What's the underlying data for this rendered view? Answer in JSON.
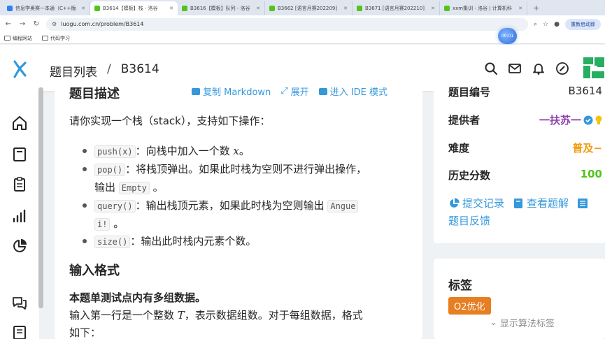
{
  "browser": {
    "tabs": [
      {
        "label": "信息学奥赛一本通（C++版",
        "favicon_color": "#2f80ed",
        "active": false
      },
      {
        "label": "B3614【模板】栈 - 洛谷",
        "favicon_color": "#52c41a",
        "active": true
      },
      {
        "label": "B3616【模板】队列 - 洛谷",
        "favicon_color": "#52c41a",
        "active": false
      },
      {
        "label": "B3662 [语言月赛202209]",
        "favicon_color": "#52c41a",
        "active": false
      },
      {
        "label": "B3671 [语言月赛202210]",
        "favicon_color": "#52c41a",
        "active": false
      },
      {
        "label": "xxm集训 - 洛谷 | 计算机科",
        "favicon_color": "#52c41a",
        "active": false
      }
    ],
    "new_tab": "+",
    "url": "luogu.com.cn/problem/B3614",
    "restart_label": "重新启动即",
    "bookmarks": [
      "编程网站",
      "代码学习"
    ],
    "recording_time": "00:01"
  },
  "header": {
    "breadcrumb_root": "题目列表",
    "breadcrumb_sep": "/",
    "breadcrumb_current": "B3614"
  },
  "problem": {
    "description_heading": "题目描述",
    "toolbar": {
      "copy_markdown": "复制 Markdown",
      "expand": "展开",
      "ide_mode": "进入 IDE 模式"
    },
    "intro": "请你实现一个栈（stack），支持如下操作：",
    "ops": {
      "push_code": "push(x)",
      "push_text": "：向栈中加入一个数 ",
      "push_var": "x",
      "push_end": "。",
      "pop_code": "pop()",
      "pop_text": "：将栈顶弹出。如果此时栈为空则不进行弹出操作，",
      "pop_text2": "输出 ",
      "pop_code2": "Empty",
      "pop_end": " 。",
      "query_code": "query()",
      "query_text": "：输出栈顶元素，如果此时栈为空则输出 ",
      "query_code2a": "Angue",
      "query_code2b": "i!",
      "query_end": " 。",
      "size_code": "size()",
      "size_text": "：输出此时栈内元素个数。"
    },
    "input_heading": "输入格式",
    "input_bold": "本题单测试点内有多组数据。",
    "input_line1a": "输入第一行是一个整数 ",
    "input_var": "T",
    "input_line1b": "，表示数据组数。对于每组数据，格式",
    "input_line2": "如下："
  },
  "info": {
    "id_label": "题目编号",
    "id_value": "B3614",
    "provider_label": "提供者",
    "provider_value": "一扶苏一",
    "difficulty_label": "难度",
    "difficulty_value": "普及−",
    "score_label": "历史分数",
    "score_value": "100",
    "submissions_link": "提交记录",
    "solutions_link": "查看题解",
    "feedback_link": "题目反馈"
  },
  "tags": {
    "heading": "标签",
    "tag_o2": "O2优化",
    "show_algo_tags": "显示算法标签"
  },
  "colors": {
    "link": "#3498db",
    "provider": "#8e44ad",
    "difficulty": "#f39c12",
    "score": "#52c41a",
    "tag": "#e67e22"
  }
}
